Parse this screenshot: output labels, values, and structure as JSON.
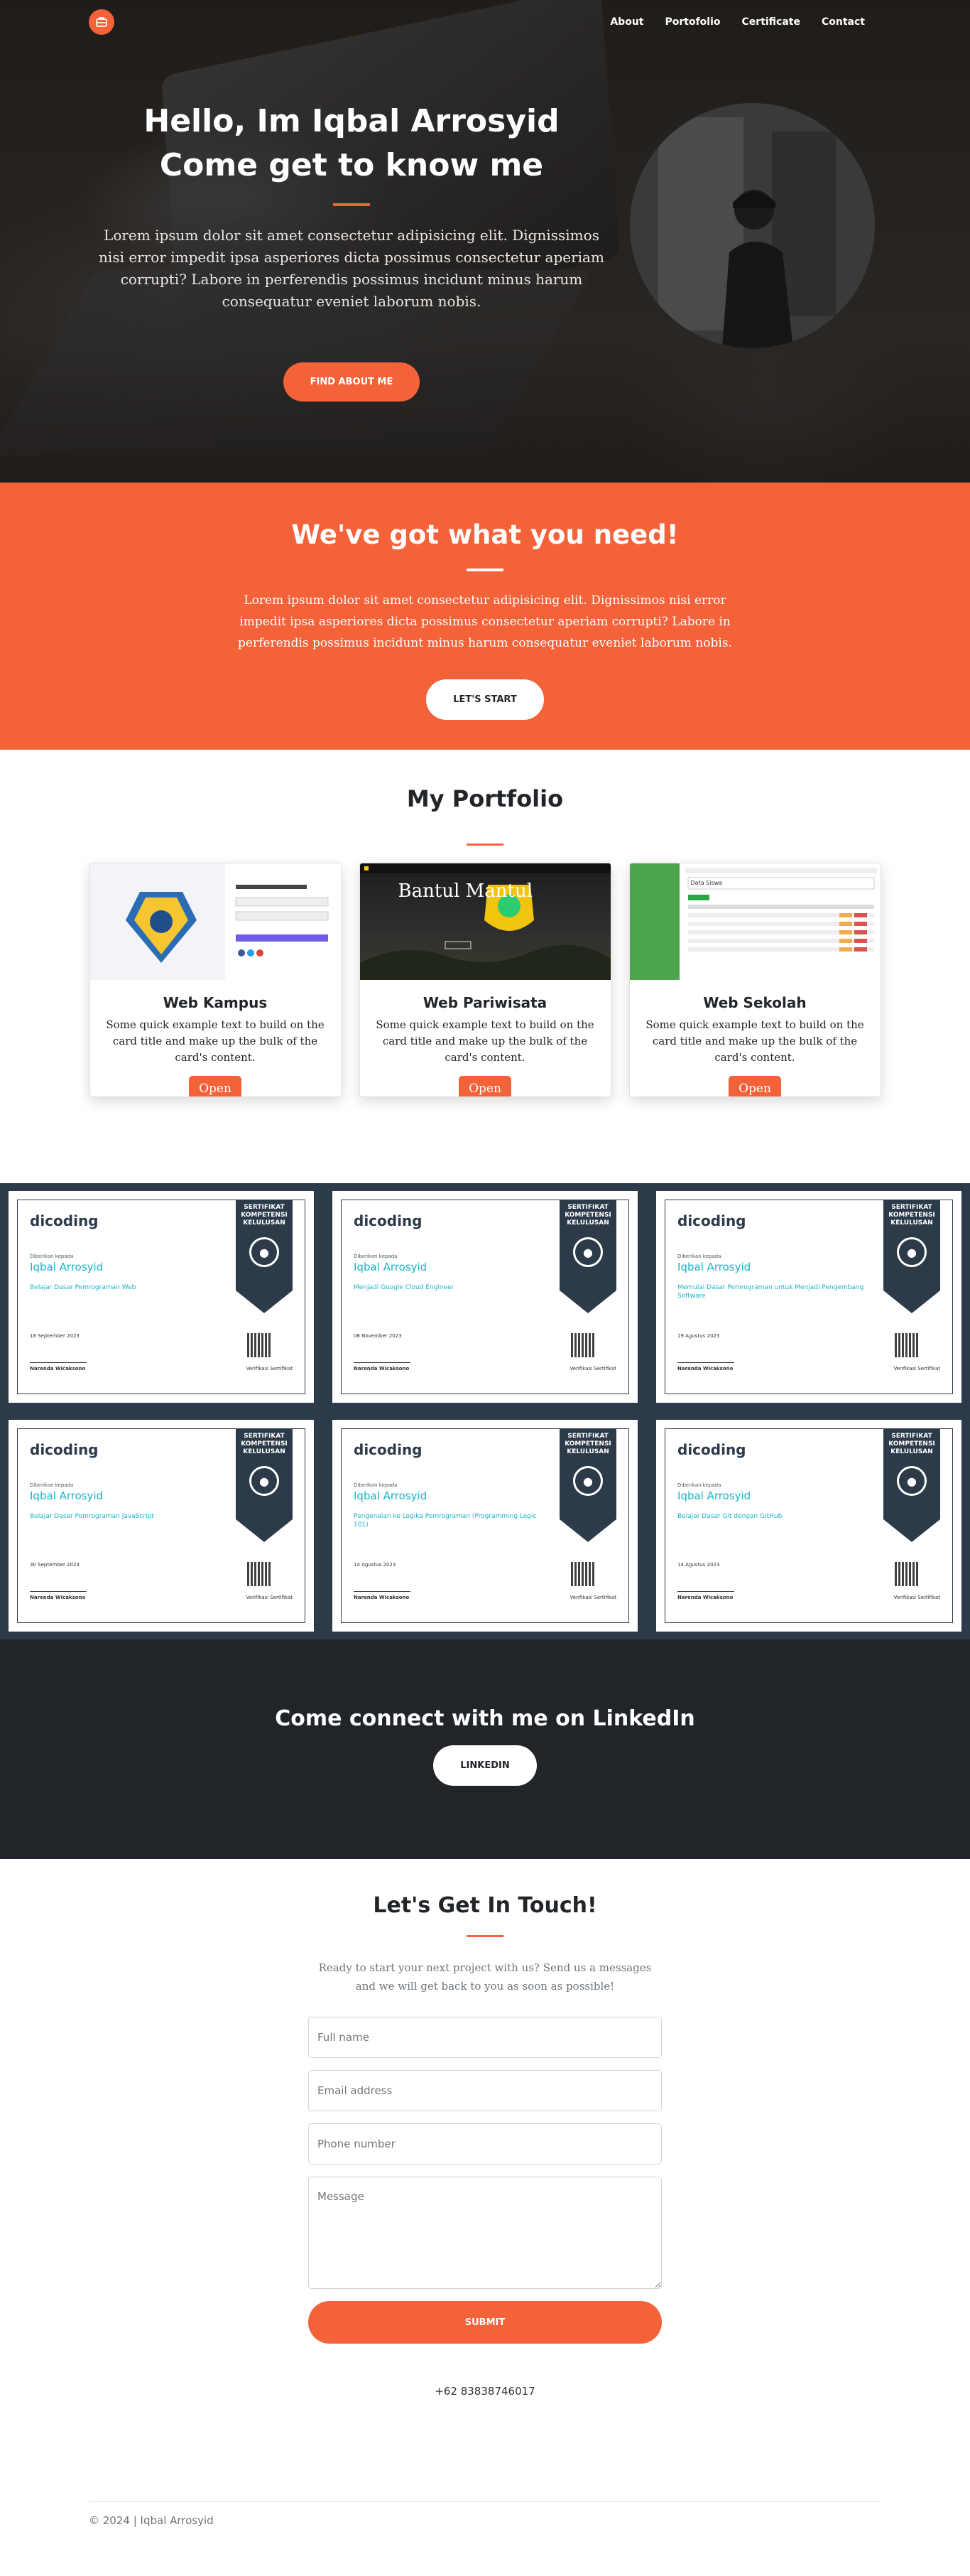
{
  "nav": {
    "links": [
      "About",
      "Portofolio",
      "Certificate",
      "Contact"
    ]
  },
  "hero": {
    "title_line1": "Hello, Im Iqbal Arrosyid",
    "title_line2": "Come get to know me",
    "text": "Lorem ipsum dolor sit amet consectetur adipisicing elit. Dignissimos nisi error impedit ipsa asperiores dicta possimus consectetur aperiam corrupti? Labore in perferendis possimus incidunt minus harum consequatur eveniet laborum nobis.",
    "button": "FIND ABOUT ME"
  },
  "need": {
    "title": "We've got what you need!",
    "text": "Lorem ipsum dolor sit amet consectetur adipisicing elit. Dignissimos nisi error impedit ipsa asperiores dicta possimus consectetur aperiam corrupti? Labore in perferendis possimus incidunt minus harum consequatur eveniet laborum nobis.",
    "button": "LET'S START"
  },
  "portfolio": {
    "title": "My Portfolio",
    "cards": [
      {
        "title": "Web Kampus",
        "text": "Some quick example text to build on the card title and make up the bulk of the card's content.",
        "button": "Open"
      },
      {
        "title": "Web Pariwisata",
        "text": "Some quick example text to build on the card title and make up the bulk of the card's content.",
        "button": "Open",
        "image_caption": "Bantul Mantul"
      },
      {
        "title": "Web Sekolah",
        "text": "Some quick example text to build on the card title and make up the bulk of the card's content.",
        "button": "Open",
        "image_caption": "Data Siswa"
      }
    ]
  },
  "certificates": {
    "logo": "dicoding",
    "badge": "SERTIFIKAT KOMPETENSI KELULUSAN",
    "given_to": "Diberikan kepada",
    "name": "Iqbal Arrosyid",
    "signer": "Narenda Wicaksono",
    "verify_label": "Verifikasi Sertifikat",
    "items": [
      {
        "course": "Belajar Dasar Pemrograman Web",
        "date": "18 September 2023"
      },
      {
        "course": "Menjadi Google Cloud Engineer",
        "date": "06 November 2023"
      },
      {
        "course": "Memulai Dasar Pemrograman untuk Menjadi Pengembang Software",
        "date": "19 Agustus 2023"
      },
      {
        "course": "Belajar Dasar Pemrograman JavaScript",
        "date": "30 September 2023"
      },
      {
        "course": "Pengenalan ke Logika Pemrograman (Programming Logic 101)",
        "date": "14 Agustus 2023"
      },
      {
        "course": "Belajar Dasar Git dengan GitHub",
        "date": "14 Agustus 2023"
      }
    ]
  },
  "linkedin": {
    "title": "Come connect with me on LinkedIn",
    "button": "LINKEDIN"
  },
  "contact": {
    "title": "Let's Get In Touch!",
    "text": "Ready to start your next project with us? Send us a messages and we will get back to you as soon as possible!",
    "fullname_placeholder": "Full name",
    "email_placeholder": "Email address",
    "phone_placeholder": "Phone number",
    "message_placeholder": "Message",
    "submit": "SUBMIT",
    "phone": "+62 83838746017"
  },
  "footer": {
    "text": "© 2024 | Iqbal Arrosyid"
  }
}
